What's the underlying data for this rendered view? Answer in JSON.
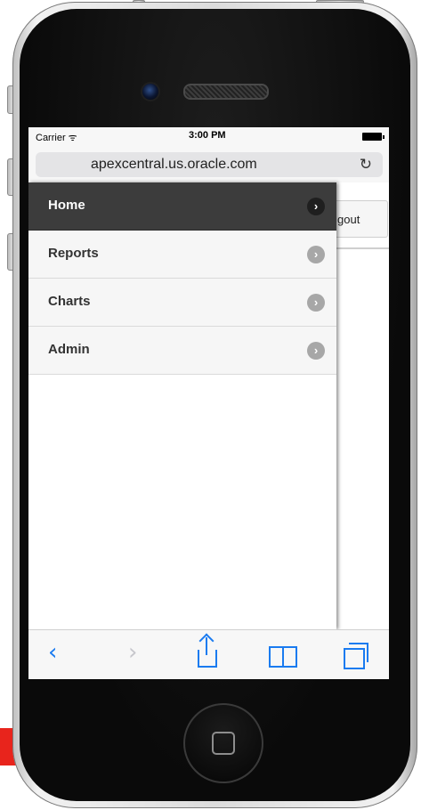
{
  "status_bar": {
    "carrier": "Carrier ᯤ",
    "time": "3:00 PM"
  },
  "browser": {
    "url": "apexcentral.us.oracle.com",
    "reload_icon": "reload-icon"
  },
  "page": {
    "logout_label": "gout"
  },
  "menu": {
    "items": [
      {
        "label": "Home",
        "active": true
      },
      {
        "label": "Reports",
        "active": false
      },
      {
        "label": "Charts",
        "active": false
      },
      {
        "label": "Admin",
        "active": false
      }
    ]
  },
  "toolbar": {
    "icons": [
      "back-icon",
      "forward-icon",
      "share-icon",
      "bookmarks-icon",
      "tabs-icon"
    ]
  },
  "colors": {
    "accent": "#1a7bf0",
    "menu_active": "#3c3c3c",
    "red_strip": "#e8241c"
  }
}
